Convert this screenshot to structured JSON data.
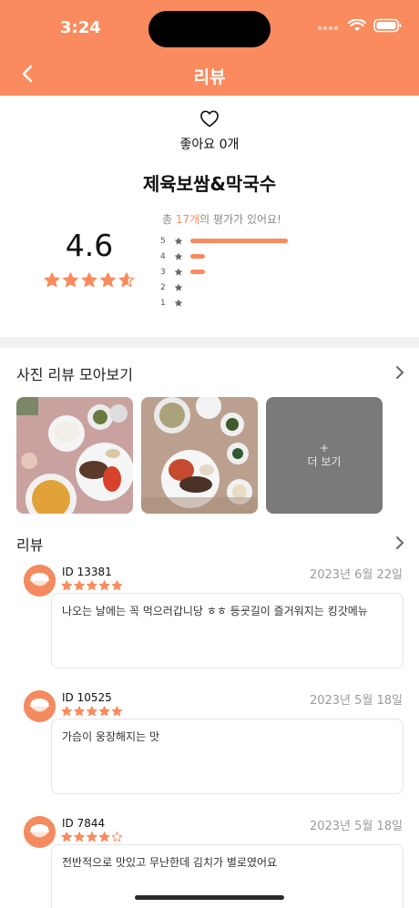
{
  "status": {
    "time": "3:24"
  },
  "nav": {
    "title": "리뷰",
    "back_icon": "chevron-left-icon"
  },
  "like": {
    "label": "좋아요 0개",
    "icon": "heart-outline-icon"
  },
  "menu": {
    "title": "제육보쌈&막국수"
  },
  "rating": {
    "average": "4.6",
    "stars_filled": 4.6,
    "summary_prefix": "총 ",
    "summary_count": "17개",
    "summary_suffix": "의 평가가 있어요!",
    "distribution": [
      {
        "label": "5",
        "share": 0.82
      },
      {
        "label": "4",
        "share": 0.12
      },
      {
        "label": "3",
        "share": 0.12
      },
      {
        "label": "2",
        "share": 0.0
      },
      {
        "label": "1",
        "share": 0.0
      }
    ]
  },
  "photo_section": {
    "title": "사진 리뷰 모아보기",
    "more_plus": "+",
    "more_label": "더 보기"
  },
  "review_section": {
    "title": "리뷰"
  },
  "reviews": [
    {
      "id": "ID 13381",
      "date": "2023년 6월 22일",
      "stars": 5,
      "text": "나오는 날에는 꼭 먹으러갑니당 ㅎㅎ 등굣길이 즐거워지는 킹갓메뉴"
    },
    {
      "id": "ID 10525",
      "date": "2023년 5월 18일",
      "stars": 5,
      "text": "가슴이 웅장해지는 맛"
    },
    {
      "id": "ID 7844",
      "date": "2023년 5월 18일",
      "stars": 4,
      "text": "전반적으로 맛있고 무난한데 김치가 별로였어요"
    }
  ],
  "colors": {
    "accent": "#F98B5E",
    "star": "#F98B5E"
  }
}
